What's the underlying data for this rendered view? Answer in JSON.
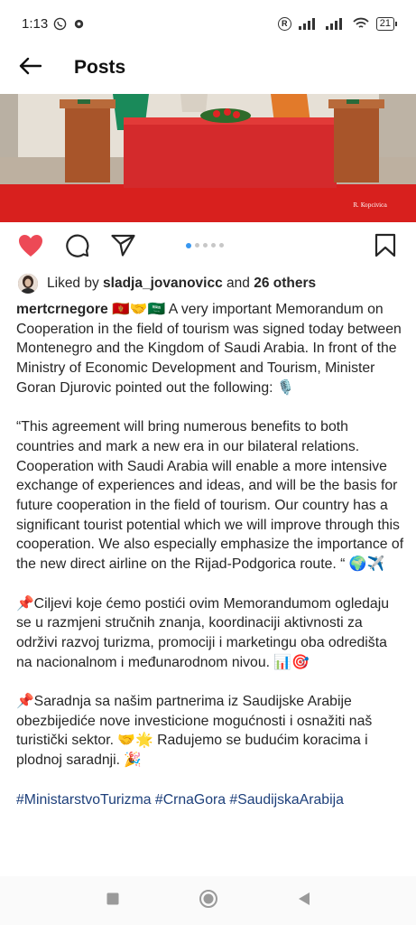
{
  "status_bar": {
    "time": "1:13",
    "r_badge": "R",
    "battery": "21"
  },
  "header": {
    "title": "Posts"
  },
  "image": {
    "watermark": "R. Kopcivica"
  },
  "likes": {
    "prefix": "Liked by ",
    "user": "sladja_jovanovicc",
    "middle": " and ",
    "count": "26 others"
  },
  "caption": {
    "username": "mertcrnegore",
    "emojis_after_user": "🇲🇪🤝🇸🇦",
    "p1": "A very important Memorandum on Cooperation in the field of tourism was signed today between Montenegro and the Kingdom of Saudi Arabia. In front of the Ministry of Economic Development and Tourism, Minister Goran Djurovic pointed out the following: 🎙️",
    "p2": "“This agreement will bring numerous benefits to both countries and mark a new era in our bilateral relations. Cooperation with Saudi Arabia will enable a more intensive exchange of experiences and ideas, and will be the basis for future cooperation in the field of tourism. Our country has a significant tourist potential which we will improve through this cooperation. We also especially emphasize the importance of the new direct airline on the Rijad-Podgorica route. “ 🌍✈️",
    "p3": "📌Ciljevi koje ćemo postići ovim Memorandumom ogledaju se u razmjeni stručnih znanja, koordinaciji aktivnosti za održivi razvoj turizma, promociji i marketingu oba odredišta na nacionalnom i međunarodnom nivou. 📊🎯",
    "p4": "📌Saradnja sa našim partnerima iz Saudijske Arabije obezbijediće nove investicione mogućnosti i osnažiti naš turistički sektor. 🤝🌟 Radujemo se budućim koracima i plodnoj saradnji. 🎉",
    "hashtags": "#MinistarstvoTurizma #CrnaGora #SaudijskaArabija"
  },
  "colors": {
    "like_red": "#ed4956",
    "carousel_active": "#3897f0",
    "hashtag": "#1d3f7a"
  },
  "icons": {
    "back": "back-arrow-icon",
    "like": "heart-icon",
    "comment": "comment-icon",
    "share": "send-icon",
    "save": "bookmark-icon",
    "nav_recents": "square-icon",
    "nav_home": "circle-icon",
    "nav_back": "triangle-icon"
  }
}
